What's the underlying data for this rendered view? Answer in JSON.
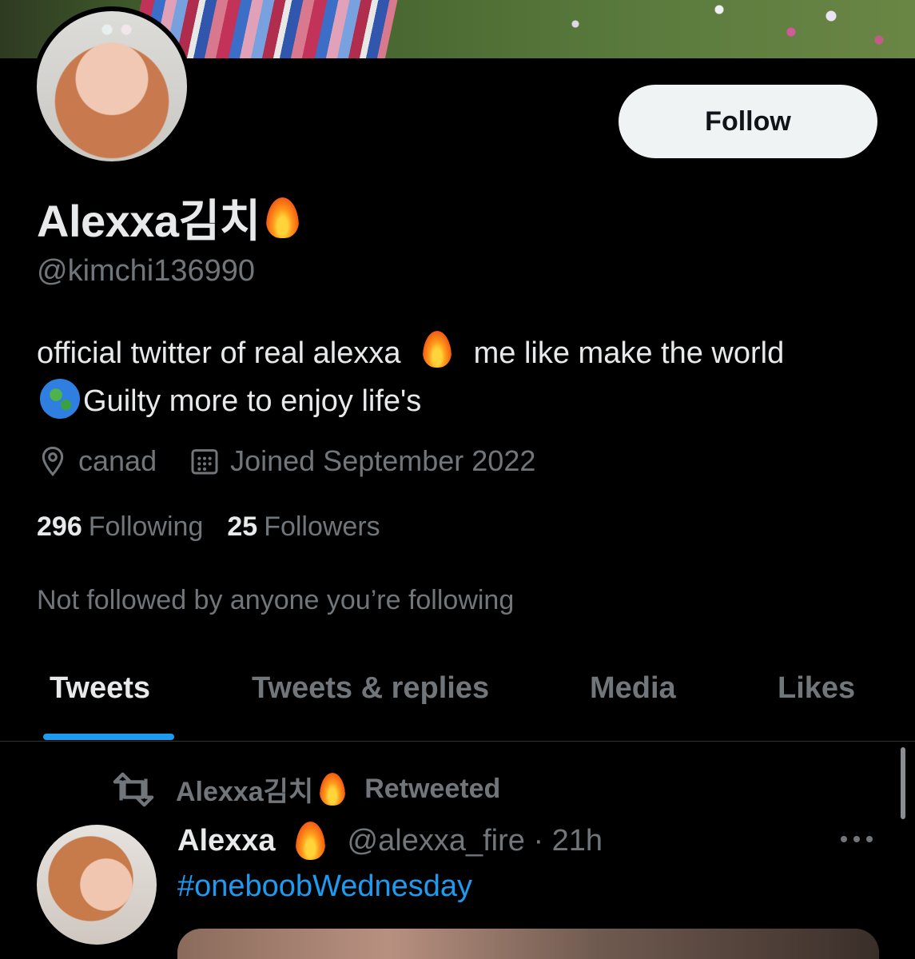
{
  "profile": {
    "display_name": "Alexxa김치",
    "handle": "@kimchi136990",
    "bio_part1": "official twitter of real alexxa",
    "bio_part2": "me like make the world",
    "bio_part3": "Guilty more to enjoy life's",
    "location": "canad",
    "joined": "Joined September 2022",
    "following_count": "296",
    "following_label": "Following",
    "followers_count": "25",
    "followers_label": "Followers",
    "mutuals_text": "Not followed by anyone you’re following",
    "follow_label": "Follow"
  },
  "tabs": [
    {
      "label": "Tweets",
      "active": true
    },
    {
      "label": "Tweets & replies",
      "active": false
    },
    {
      "label": "Media",
      "active": false
    },
    {
      "label": "Likes",
      "active": false
    }
  ],
  "tweet": {
    "retweeter": "Alexxa김치",
    "retweeted_label": "Retweeted",
    "author": "Alexxa",
    "handle_time": "@alexxa_fire · 21h",
    "hashtag": "#oneboobWednesday"
  },
  "colors": {
    "accent": "#1d9bf0",
    "background": "#000000",
    "text_primary": "#e7e9ea",
    "text_secondary": "#71767b",
    "follow_button_bg": "#eff3f4"
  },
  "icons": [
    "fire-icon",
    "globe-icon",
    "location-pin-icon",
    "calendar-icon",
    "retweet-icon",
    "more-icon"
  ]
}
